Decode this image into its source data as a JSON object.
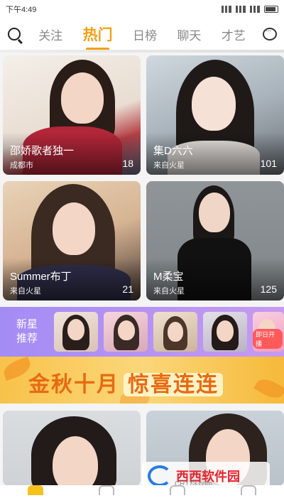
{
  "status_bar": {
    "time": "下午4:49"
  },
  "nav": {
    "tabs": [
      {
        "label": "关注",
        "active": false
      },
      {
        "label": "热门",
        "active": true
      },
      {
        "label": "日榜",
        "active": false
      },
      {
        "label": "聊天",
        "active": false
      },
      {
        "label": "才艺",
        "active": false
      }
    ],
    "search_icon": "search-icon",
    "message_icon": "message-icon",
    "accent_color": "#f4a017"
  },
  "cards": [
    {
      "name": "邵娇歌者独一",
      "location": "成都市",
      "count": "18"
    },
    {
      "name": "集D六六",
      "location": "来自火星",
      "count": "101"
    },
    {
      "name": "Summer布丁",
      "location": "来自火星",
      "count": "21"
    },
    {
      "name": "M柔宝",
      "location": "来自火星",
      "count": "125"
    }
  ],
  "recommend": {
    "label_line1": "新星",
    "label_line2": "推荐",
    "badge": "即日开播"
  },
  "banner": {
    "text_part1": "金秋十月",
    "text_part2": "惊喜连连"
  },
  "watermark": {
    "title": "西西软件园",
    "sub": "CR173.com"
  }
}
